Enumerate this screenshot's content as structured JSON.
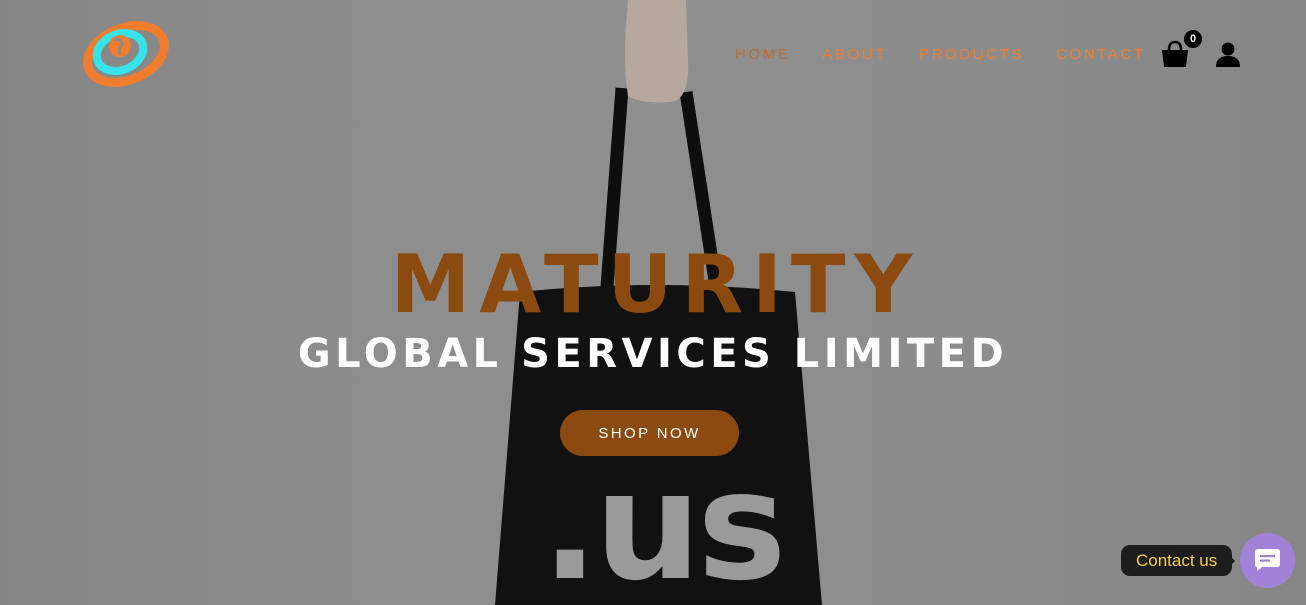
{
  "brand": {
    "logo_icon": "globe-swoosh-logo",
    "colors": {
      "orange": "#f07d2e",
      "cyan": "#35e3e8"
    }
  },
  "nav": {
    "items": [
      {
        "label": "HOME",
        "active": true
      },
      {
        "label": "ABOUT",
        "active": false
      },
      {
        "label": "PRODUCTS",
        "active": false
      },
      {
        "label": "CONTACT",
        "active": false
      }
    ]
  },
  "cart": {
    "icon": "shopping-bag-icon",
    "count": "0"
  },
  "account": {
    "icon": "user-icon"
  },
  "hero": {
    "title": "MATURITY",
    "subtitle": "GLOBAL SERVICES LIMITED",
    "cta_label": "SHOP NOW",
    "bag_print": ".us",
    "accent_color": "#8b4a0f"
  },
  "chat": {
    "label": "Contact us",
    "icon": "chat-message-icon",
    "button_color": "#a182d6",
    "label_color": "#f7cf45"
  }
}
